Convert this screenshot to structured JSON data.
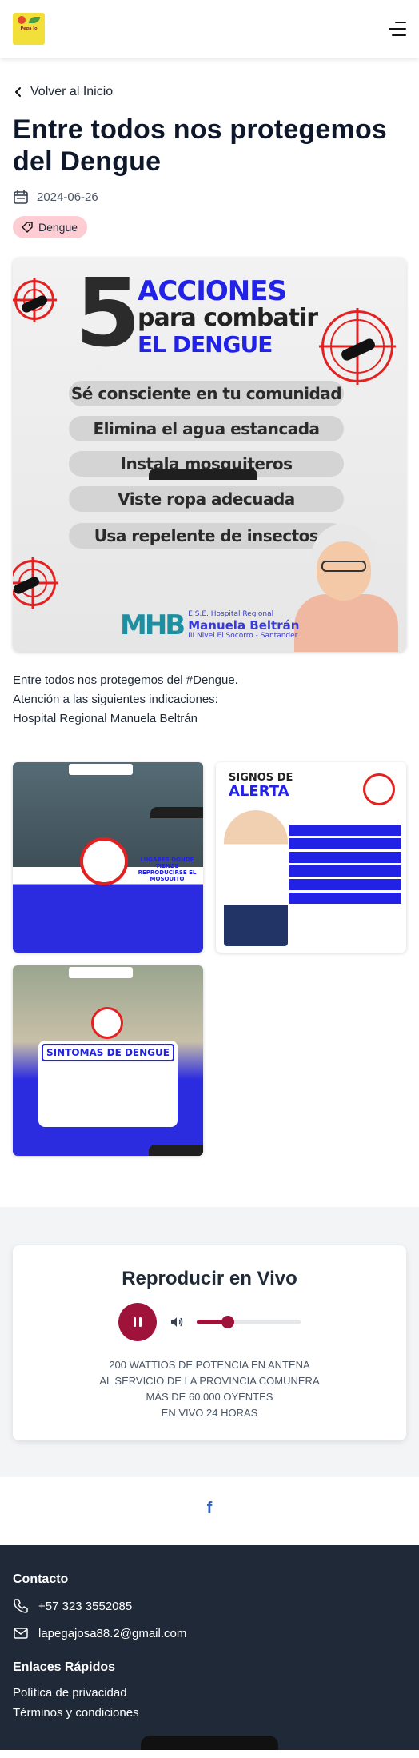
{
  "header": {
    "logo_text": "Pega Jo",
    "menu_icon": "hamburger-menu-icon"
  },
  "nav": {
    "back_label": "Volver al Inicio"
  },
  "post": {
    "title": "Entre todos nos protegemos del Dengue",
    "date": "2024-06-26",
    "tag": "Dengue",
    "description_lines": [
      "Entre todos nos protegemos del #Dengue.",
      "Atención a las siguientes indicaciones:",
      "Hospital Regional Manuela Beltrán"
    ]
  },
  "featured_image": {
    "big_number": "5",
    "line1": "ACCIONES",
    "line2": "para combatir",
    "line3": "EL DENGUE",
    "actions": [
      "Sé consciente en tu comunidad",
      "Elimina el agua estancada",
      "Instala mosquiteros",
      "Viste ropa adecuada",
      "Usa repelente de insectos"
    ],
    "logo_mark": "MHB",
    "logo_line1": "E.S.E. Hospital Regional",
    "logo_line2": "Manuela Beltrán",
    "logo_line3": "III Nivel  El Socorro - Santander"
  },
  "gallery": {
    "g1_title": "LUGARES DONDE TIENDE REPRODUCIRSE EL MOSQUITO",
    "g2_title_1": "SIGNOS DE",
    "g2_title_2": "ALERTA",
    "g3_title": "SINTOMAS DE DENGUE"
  },
  "radio": {
    "title": "Reproducir en Vivo",
    "volume_fraction": 0.3,
    "lines": [
      "200 WATTIOS DE POTENCIA EN ANTENA",
      "AL SERVICIO DE LA PROVINCIA COMUNERA",
      "MÁS DE 60.000 OYENTES",
      "EN VIVO 24 HORAS"
    ]
  },
  "social": {
    "facebook_label": "f"
  },
  "footer": {
    "contact_title": "Contacto",
    "phone": "+57 323 3552085",
    "email": "lapegajosa88.2@gmail.com",
    "links_title": "Enlaces Rápidos",
    "link_privacy": "Política de privacidad",
    "link_terms": "Términos y condiciones"
  },
  "colors": {
    "accent": "#9f1239",
    "tag_bg": "#fecdd3",
    "footer_bg": "#1f2937",
    "poster_blue": "#2222e6"
  }
}
